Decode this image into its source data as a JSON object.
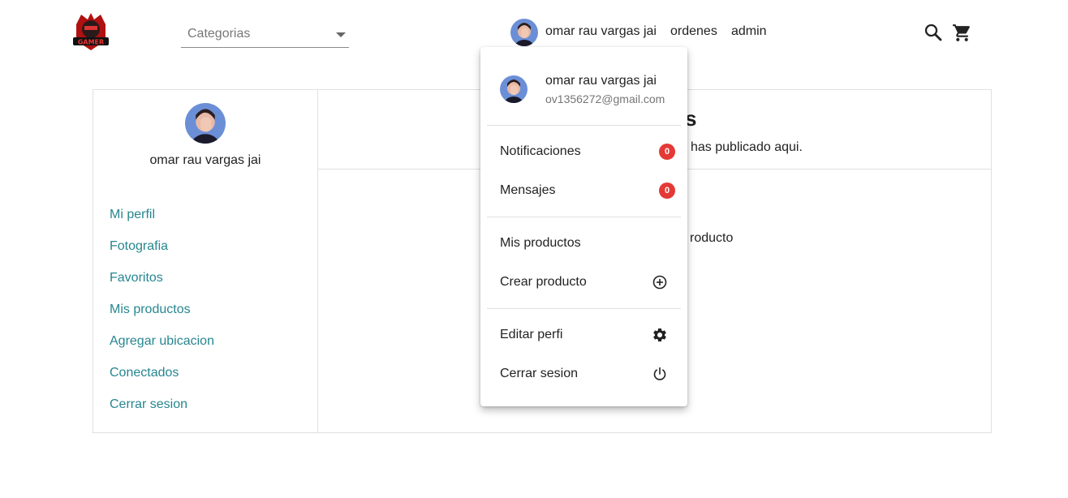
{
  "header": {
    "logo_text": "GAMER",
    "categories_placeholder": "Categorias",
    "user_name": "omar rau vargas jai",
    "ordenes_label": "ordenes",
    "admin_label": "admin",
    "icons": [
      "search-icon",
      "cart-icon"
    ]
  },
  "sidebar": {
    "user_name": "omar rau vargas jai",
    "items": [
      {
        "label": "Mi perfil"
      },
      {
        "label": "Fotografia"
      },
      {
        "label": "Favoritos"
      },
      {
        "label": "Mis productos"
      },
      {
        "label": "Agregar ubicacion"
      },
      {
        "label": "Conectados"
      },
      {
        "label": "Cerrar sesion"
      }
    ]
  },
  "content": {
    "title_visible": "ctos",
    "subtitle_visible": "has publicado aqui.",
    "empty_visible": "roducto"
  },
  "dropdown": {
    "user_name": "omar rau vargas jai",
    "email": "ov1356272@gmail.com",
    "notificaciones_label": "Notificaciones",
    "notificaciones_count": "0",
    "mensajes_label": "Mensajes",
    "mensajes_count": "0",
    "mis_productos_label": "Mis productos",
    "crear_producto_label": "Crear producto",
    "editar_perfil_label": "Editar perfi",
    "cerrar_sesion_label": "Cerrar sesion"
  },
  "colors": {
    "link": "#26868f",
    "badge": "#e53935",
    "border": "#e0e0e0"
  }
}
